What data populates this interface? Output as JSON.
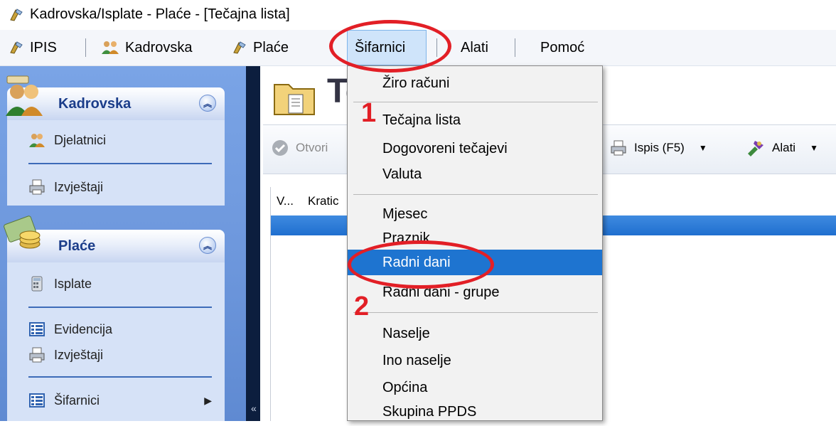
{
  "window": {
    "title": "Kadrovska/Isplate - Plaće - [Tečajna lista]"
  },
  "menubar": {
    "items": [
      "IPIS",
      "Kadrovska",
      "Plaće",
      "Šifarnici",
      "Alati",
      "Pomoć"
    ]
  },
  "sidebar": {
    "groups": [
      {
        "title": "Kadrovska",
        "items": [
          "Djelatnici",
          "Izvještaji"
        ]
      },
      {
        "title": "Plaće",
        "items": [
          "Isplate",
          "Evidencija",
          "Izvještaji",
          "Šifarnici"
        ]
      }
    ]
  },
  "main": {
    "page_title": "Te",
    "toolbar": {
      "open": "Otvori",
      "print": "Ispis (F5)",
      "tools": "Alati"
    },
    "grid": {
      "columns": [
        "V...",
        "Kratic"
      ]
    }
  },
  "dropdown": {
    "items": [
      "Žiro računi",
      "Tečajna lista",
      "Dogovoreni tečajevi",
      "Valuta",
      "Mjesec",
      "Praznik",
      "Radni dani",
      "Radni dani - grupe",
      "Naselje",
      "Ino naselje",
      "Općina",
      "Skupina PPDS"
    ],
    "selected": "Radni dani"
  },
  "annotations": {
    "step1": "1",
    "step2": "2"
  },
  "colors": {
    "accent": "#1e74d0",
    "annotation": "#e21f26",
    "sidebar": "#6e98dd"
  }
}
